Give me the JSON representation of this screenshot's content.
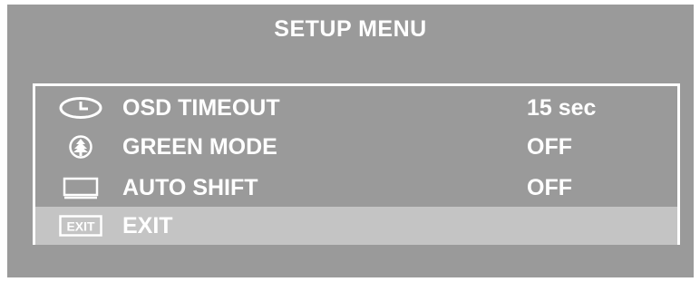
{
  "title": "SETUP MENU",
  "items": [
    {
      "icon": "clock-icon",
      "label": "OSD TIMEOUT",
      "value": "15 sec",
      "selected": false
    },
    {
      "icon": "tree-icon",
      "label": "GREEN MODE",
      "value": "OFF",
      "selected": false
    },
    {
      "icon": "monitor-icon",
      "label": "AUTO SHIFT",
      "value": "OFF",
      "selected": false
    },
    {
      "icon": "exit-icon",
      "label": "EXIT",
      "value": "",
      "selected": true
    }
  ],
  "exit_icon_text": "EXIT",
  "colors": {
    "panel": "#9a9a9a",
    "highlight": "#c4c4c4",
    "text": "#ffffff"
  }
}
